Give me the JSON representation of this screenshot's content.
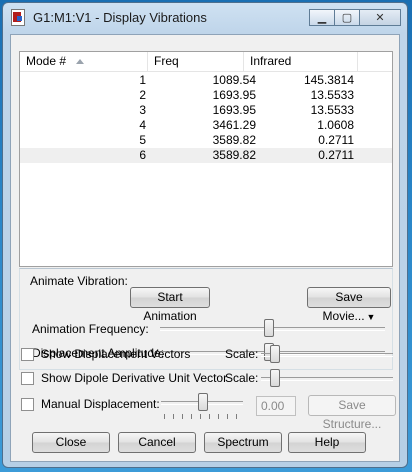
{
  "window": {
    "title": "G1:M1:V1 - Display Vibrations"
  },
  "table": {
    "headers": [
      "Mode #",
      "Freq",
      "Infrared"
    ],
    "rows": [
      {
        "mode": "1",
        "freq": "1089.54",
        "ir": "145.3814"
      },
      {
        "mode": "2",
        "freq": "1693.95",
        "ir": "13.5533"
      },
      {
        "mode": "3",
        "freq": "1693.95",
        "ir": "13.5533"
      },
      {
        "mode": "4",
        "freq": "3461.29",
        "ir": "1.0608"
      },
      {
        "mode": "5",
        "freq": "3589.82",
        "ir": "0.2711"
      },
      {
        "mode": "6",
        "freq": "3589.82",
        "ir": "0.2711"
      }
    ]
  },
  "animate": {
    "group_label": "Animate Vibration:",
    "start_button": "Start Animation",
    "save_movie_button": "Save Movie...",
    "frequency_label": "Animation Frequency:",
    "amplitude_label": "Displacement Amplitude:"
  },
  "options": {
    "show_displacement": "Show Displacement Vectors",
    "show_dipole": "Show Dipole Derivative Unit Vector",
    "scale_label": "Scale:",
    "manual_label": "Manual Displacement:",
    "manual_value": "0.00",
    "save_structure": "Save Structure..."
  },
  "buttons": {
    "close": "Close",
    "cancel": "Cancel",
    "spectrum": "Spectrum",
    "help": "Help"
  }
}
